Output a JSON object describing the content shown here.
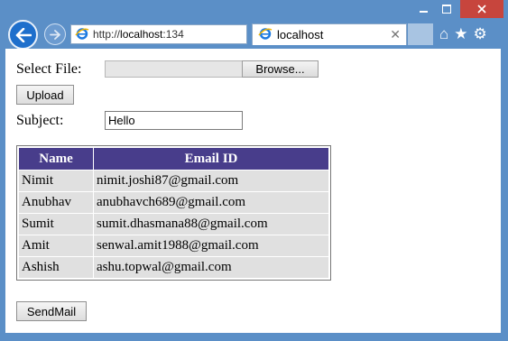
{
  "browser": {
    "address": {
      "prefix": "http://",
      "host": "localhost",
      "suffix": ":134"
    },
    "tab_title": "localhost"
  },
  "form": {
    "select_file_label": "Select File:",
    "browse_label": "Browse...",
    "upload_label": "Upload",
    "subject_label": "Subject:",
    "subject_value": "Hello",
    "sendmail_label": "SendMail"
  },
  "table": {
    "headers": [
      "Name",
      "Email ID"
    ],
    "rows": [
      [
        "Nimit",
        "nimit.joshi87@gmail.com"
      ],
      [
        "Anubhav",
        "anubhavch689@gmail.com"
      ],
      [
        "Sumit",
        "sumit.dhasmana88@gmail.com"
      ],
      [
        "Amit",
        "senwal.amit1988@gmail.com"
      ],
      [
        "Ashish",
        "ashu.topwal@gmail.com"
      ]
    ]
  },
  "colors": {
    "header_bg": "#483d8b",
    "row_bg": "#e0e0e0",
    "chrome": "#5b8fc7"
  }
}
